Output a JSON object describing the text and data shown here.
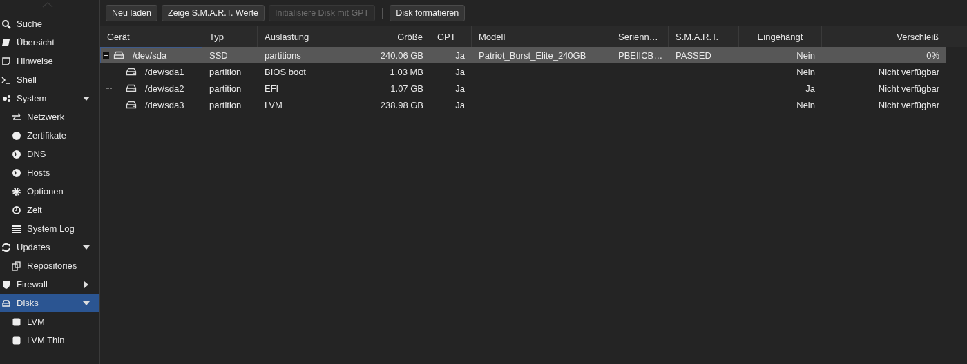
{
  "sidebar": {
    "items": [
      {
        "label": "Suche",
        "selected": false
      },
      {
        "label": "Übersicht",
        "selected": false
      },
      {
        "label": "Hinweise",
        "selected": false
      },
      {
        "label": "Shell",
        "selected": false
      },
      {
        "label": "System",
        "selected": false,
        "expanded": true,
        "children": [
          {
            "label": "Netzwerk",
            "selected": false
          },
          {
            "label": "Zertifikate",
            "selected": false
          },
          {
            "label": "DNS",
            "selected": false
          },
          {
            "label": "Hosts",
            "selected": false
          },
          {
            "label": "Optionen",
            "selected": false
          },
          {
            "label": "Zeit",
            "selected": false
          },
          {
            "label": "System Log",
            "selected": false
          }
        ]
      },
      {
        "label": "Updates",
        "selected": false,
        "expanded": true,
        "children": [
          {
            "label": "Repositories",
            "selected": false
          }
        ]
      },
      {
        "label": "Firewall",
        "selected": false,
        "expanded": false
      },
      {
        "label": "Disks",
        "selected": true,
        "expanded": true,
        "children": [
          {
            "label": "LVM",
            "selected": false
          },
          {
            "label": "LVM Thin",
            "selected": false
          }
        ]
      }
    ]
  },
  "toolbar": {
    "buttons": [
      {
        "label": "Neu laden",
        "disabled": false
      },
      {
        "label": "Zeige S.M.A.R.T. Werte",
        "disabled": false
      },
      {
        "label": "Initialisiere Disk mit GPT",
        "disabled": true
      },
      {
        "label": "Disk formatieren",
        "disabled": false
      }
    ]
  },
  "table": {
    "columns": [
      "Gerät",
      "Typ",
      "Auslastung",
      "Größe",
      "GPT",
      "Modell",
      "Serienn…",
      "S.M.A.R.T.",
      "Eingehängt",
      "Verschleiß"
    ],
    "rows": [
      {
        "cells": [
          "/dev/sda",
          "SSD",
          "partitions",
          "240.06 GB",
          "Ja",
          "Patriot_Burst_Elite_240GB",
          "PBEIICB…",
          "PASSED",
          "Nein",
          "0%"
        ],
        "selected": true,
        "expanded": true,
        "children": [
          {
            "cells": [
              "/dev/sda1",
              "partition",
              "BIOS boot",
              "1.03 MB",
              "Ja",
              "",
              "",
              "",
              "Nein",
              "Nicht verfügbar"
            ],
            "selected": false
          },
          {
            "cells": [
              "/dev/sda2",
              "partition",
              "EFI",
              "1.07 GB",
              "Ja",
              "",
              "",
              "",
              "Ja",
              "Nicht verfügbar"
            ],
            "selected": false
          },
          {
            "cells": [
              "/dev/sda3",
              "partition",
              "LVM",
              "238.98 GB",
              "Ja",
              "",
              "",
              "",
              "Nein",
              "Nicht verfügbar"
            ],
            "selected": false
          }
        ]
      }
    ]
  }
}
